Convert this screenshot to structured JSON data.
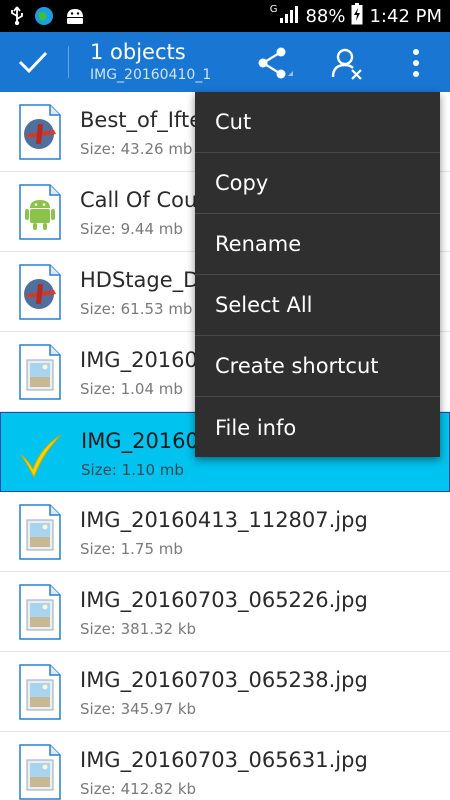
{
  "status_bar": {
    "battery_percent": "88%",
    "time": "1:42 PM",
    "network_type": "G",
    "icons": [
      "usb-icon",
      "browser-icon",
      "android-icon",
      "signal-icon",
      "battery-icon"
    ]
  },
  "action_bar": {
    "title": "1 objects",
    "subtitle": "IMG_20160410_1",
    "color": "#1976d2",
    "icons": [
      "check-icon",
      "share-icon",
      "user-remove-icon",
      "more-vert-icon"
    ]
  },
  "files": [
    {
      "name": "Best_of_Ifte",
      "size": "Size: 43.26 mb",
      "icon": "plane-file-icon",
      "selected": false
    },
    {
      "name": "Call Of Cour",
      "size": "Size: 9.44 mb",
      "icon": "android-apk-icon",
      "selected": false
    },
    {
      "name": "HDStage_D",
      "size": "Size: 61.53 mb",
      "icon": "plane-file-icon",
      "selected": false
    },
    {
      "name": "IMG_20160",
      "size": "Size: 1.04 mb",
      "icon": "image-file-icon",
      "selected": false
    },
    {
      "name": "IMG_20160",
      "size": "Size: 1.10 mb",
      "icon": "checkmark-icon",
      "selected": true
    },
    {
      "name": "IMG_20160413_112807.jpg",
      "size": "Size: 1.75 mb",
      "icon": "image-file-icon",
      "selected": false
    },
    {
      "name": "IMG_20160703_065226.jpg",
      "size": "Size: 381.32 kb",
      "icon": "image-file-icon",
      "selected": false
    },
    {
      "name": "IMG_20160703_065238.jpg",
      "size": "Size: 345.97 kb",
      "icon": "image-file-icon",
      "selected": false
    },
    {
      "name": "IMG_20160703_065631.jpg",
      "size": "Size: 412.82 kb",
      "icon": "image-file-icon",
      "selected": false
    }
  ],
  "context_menu": {
    "items": [
      "Cut",
      "Copy",
      "Rename",
      "Select All",
      "Create shortcut",
      "File info"
    ],
    "background": "#2f2f2f"
  },
  "colors": {
    "selection": "#00c3ef",
    "selection_check": "#f2d400"
  }
}
